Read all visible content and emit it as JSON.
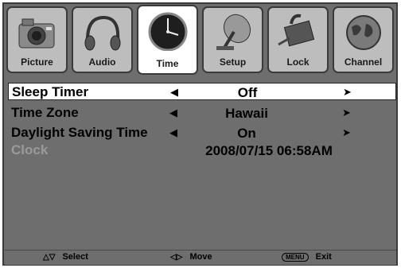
{
  "tabs": [
    {
      "label": "Picture",
      "icon": "camera-icon"
    },
    {
      "label": "Audio",
      "icon": "headphones-icon"
    },
    {
      "label": "Time",
      "icon": "clock-icon",
      "active": true
    },
    {
      "label": "Setup",
      "icon": "satellite-dish-icon"
    },
    {
      "label": "Lock",
      "icon": "lock-icon"
    },
    {
      "label": "Channel",
      "icon": "globe-icon"
    }
  ],
  "settings": {
    "sleep_timer": {
      "label": "Sleep Timer",
      "value": "Off"
    },
    "time_zone": {
      "label": "Time Zone",
      "value": "Hawaii"
    },
    "dst": {
      "label": "Daylight Saving Time",
      "value": "On"
    },
    "clock": {
      "label": "Clock",
      "value": "2008/07/15  06:58AM"
    }
  },
  "footer": {
    "select_label": "Select",
    "move_label": "Move",
    "menu_button": "MENU",
    "exit_label": "Exit"
  },
  "colors": {
    "background": "#6e6e6e",
    "tab": "#bdbdbd",
    "active_tab": "#ffffff",
    "disabled_text": "#9a9a9a"
  }
}
